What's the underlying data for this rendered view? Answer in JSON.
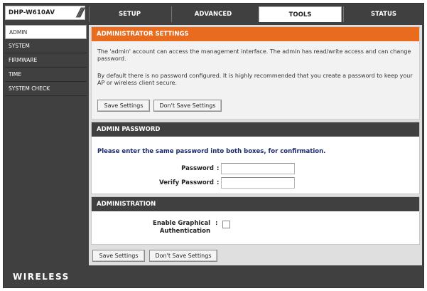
{
  "header": {
    "model": "DHP-W610AV",
    "tabs": [
      {
        "label": "SETUP",
        "active": false
      },
      {
        "label": "ADVANCED",
        "active": false
      },
      {
        "label": "TOOLS",
        "active": true
      },
      {
        "label": "STATUS",
        "active": false
      }
    ]
  },
  "sidebar": {
    "items": [
      {
        "label": "ADMIN",
        "active": true
      },
      {
        "label": "SYSTEM",
        "active": false
      },
      {
        "label": "FIRMWARE",
        "active": false
      },
      {
        "label": "TIME",
        "active": false
      },
      {
        "label": "SYSTEM CHECK",
        "active": false
      }
    ]
  },
  "admin_settings": {
    "title": "ADMINISTRATOR SETTINGS",
    "paragraph1": "The 'admin' account can access the management interface. The admin has read/write access and can change password.",
    "paragraph2": "By default there is no password configured. It is highly recommended that you create a password to keep your AP or wireless client secure.",
    "save_label": "Save Settings",
    "dont_save_label": "Don't Save Settings"
  },
  "admin_password": {
    "title": "ADMIN PASSWORD",
    "instruction": "Please enter the same password into both boxes, for confirmation.",
    "password_label": "Password",
    "verify_label": "Verify Password",
    "colon": ":",
    "password_value": "",
    "verify_value": ""
  },
  "administration": {
    "title": "ADMINISTRATION",
    "graphical_auth_line1": "Enable Graphical",
    "graphical_auth_line2": "Authentication",
    "colon": ":",
    "graphical_auth_checked": false
  },
  "bottom_buttons": {
    "save_label": "Save Settings",
    "dont_save_label": "Don't Save Settings"
  },
  "footer": {
    "brand": "WIRELESS"
  },
  "colors": {
    "accent_orange": "#e96b1e",
    "dark_gray": "#404040",
    "instruction_blue": "#1c2a6e"
  }
}
